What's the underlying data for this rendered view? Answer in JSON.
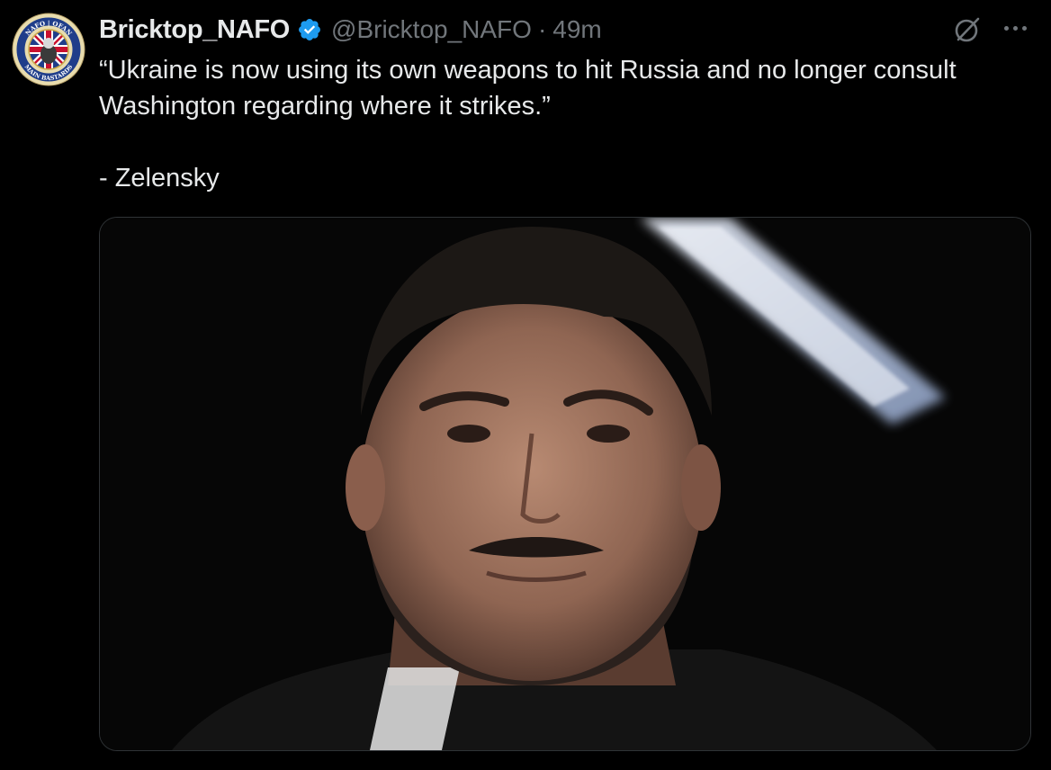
{
  "tweet": {
    "display_name": "Bricktop_NAFO",
    "handle": "@Bricktop_NAFO",
    "separator": "·",
    "time": "49m",
    "text": "“Ukraine is now using its own weapons to hit Russia and no longer consult Washington regarding where it strikes.”\n\n- Zelensky",
    "avatar_text_top": "NAFO | OFAN",
    "avatar_text_bottom": "MAIN BASTARDS"
  },
  "icons": {
    "verified": "verified-badge-icon",
    "grok": "grok-icon",
    "more": "more-options-icon"
  },
  "colors": {
    "background": "#000000",
    "text_primary": "#e7e9ea",
    "text_secondary": "#71767b",
    "verified_blue": "#1d9bf0",
    "border": "#2f3336"
  }
}
